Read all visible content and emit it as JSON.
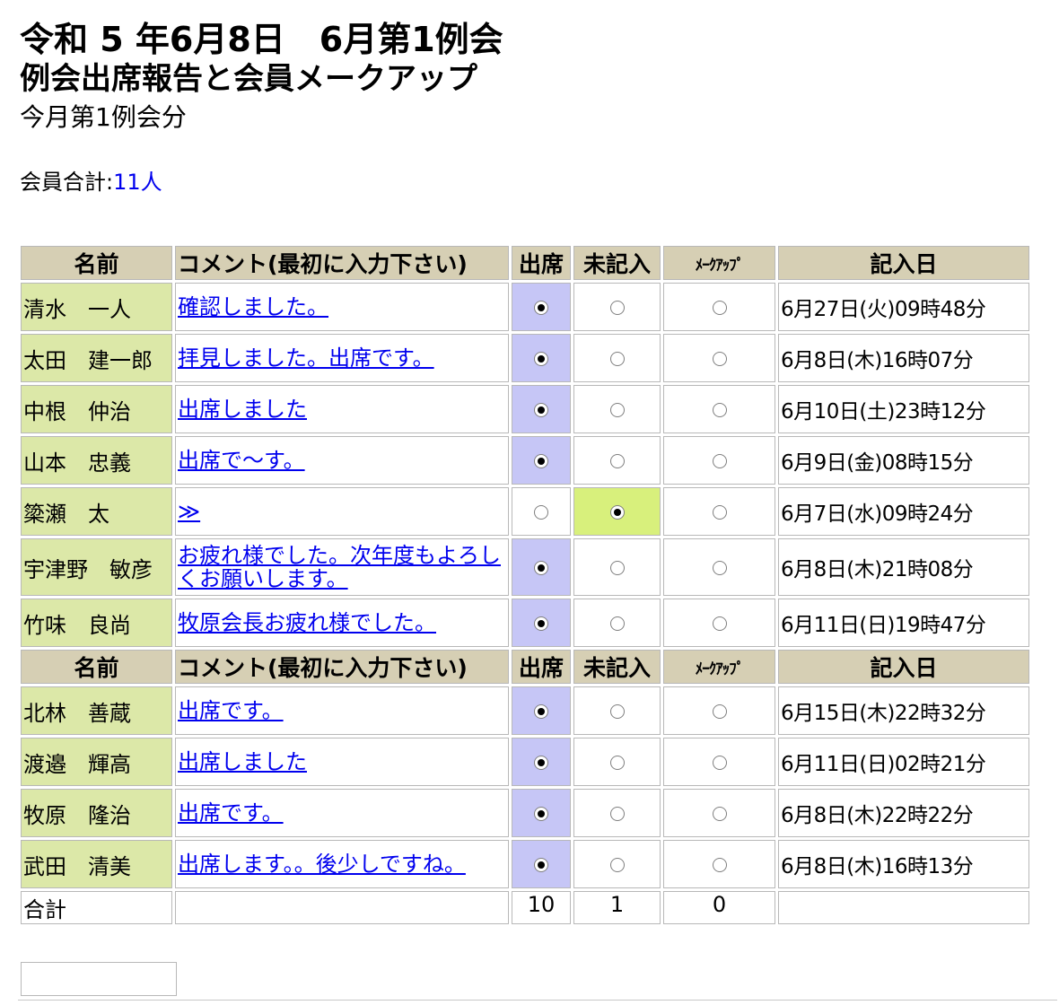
{
  "header": {
    "title_line1": "令和 5 年6月8日　6月第1例会",
    "title_line2": "例会出席報告と会員メークアップ",
    "title_line3": "今月第1例会分"
  },
  "summary": {
    "label": "会員合計:",
    "count": "11人"
  },
  "columns": {
    "name": "名前",
    "comment": "コメント(最初に入力下さい)",
    "attend": "出席",
    "unrecorded": "未記入",
    "makeup": "ﾒｰｸｱｯﾌﾟ",
    "date": "記入日"
  },
  "group1": [
    {
      "name": "清水　一人",
      "comment": "確認しました。",
      "status": "attend",
      "date": "6月27日(火)09時48分"
    },
    {
      "name": "太田　建一郎",
      "comment": "拝見しました。出席です。",
      "status": "attend",
      "date": "6月8日(木)16時07分"
    },
    {
      "name": "中根　仲治",
      "comment": "出席しました",
      "status": "attend",
      "date": "6月10日(土)23時12分"
    },
    {
      "name": "山本　忠義",
      "comment": "出席で〜す。",
      "status": "attend",
      "date": "6月9日(金)08時15分"
    },
    {
      "name": "簗瀬　太",
      "comment": "≫",
      "status": "unrecorded",
      "date": "6月7日(水)09時24分"
    },
    {
      "name": "宇津野　敏彦",
      "comment": "お疲れ様でした。次年度もよろしくお願いします。",
      "status": "attend",
      "date": "6月8日(木)21時08分"
    },
    {
      "name": "竹味　良尚",
      "comment": "牧原会長お疲れ様でした。",
      "status": "attend",
      "date": "6月11日(日)19時47分"
    }
  ],
  "group2": [
    {
      "name": "北林　善蔵",
      "comment": "出席です。",
      "status": "attend",
      "date": "6月15日(木)22時32分"
    },
    {
      "name": "渡邉　輝高",
      "comment": "出席しました",
      "status": "attend",
      "date": "6月11日(日)02時21分"
    },
    {
      "name": "牧原　隆治",
      "comment": "出席です。",
      "status": "attend",
      "date": "6月8日(木)22時22分"
    },
    {
      "name": "武田　清美",
      "comment": "出席します。。後少しですね。",
      "status": "attend",
      "date": "6月8日(木)16時13分"
    }
  ],
  "totals": {
    "label": "合計",
    "attend": "10",
    "unrecorded": "1",
    "makeup": "0"
  }
}
